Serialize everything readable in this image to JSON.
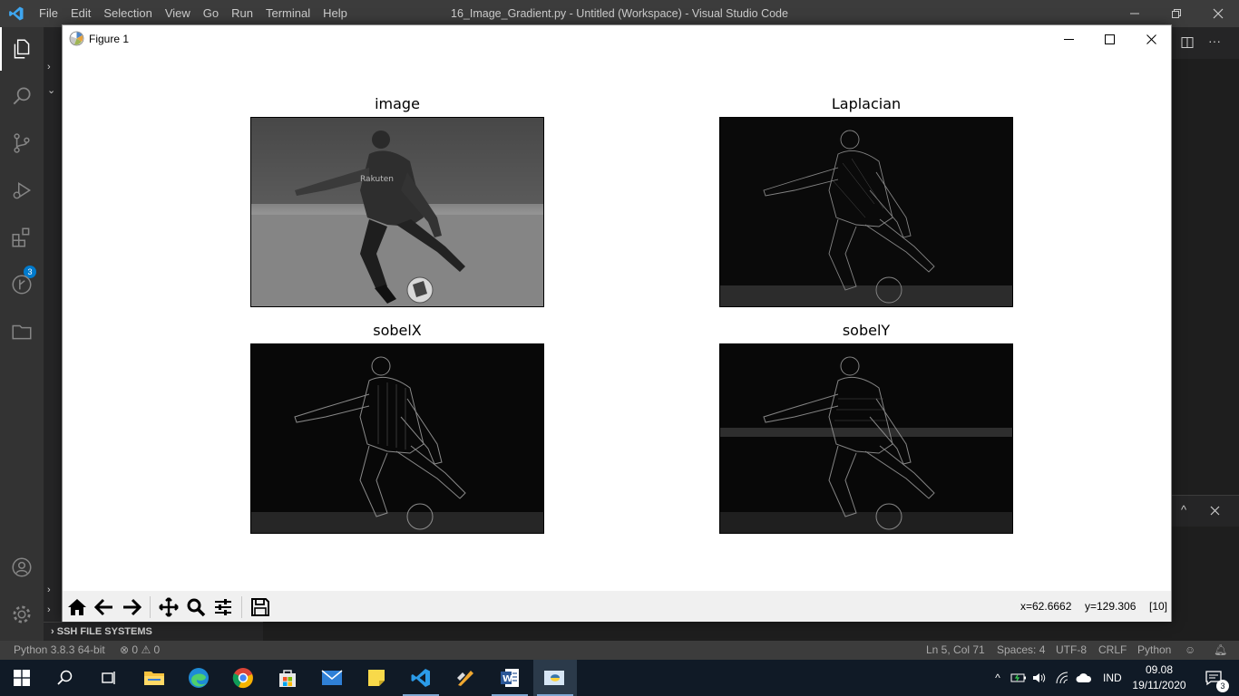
{
  "vscode": {
    "menu": [
      "File",
      "Edit",
      "Selection",
      "View",
      "Go",
      "Run",
      "Terminal",
      "Help"
    ],
    "window_title": "16_Image_Gradient.py - Untitled (Workspace) - Visual Studio Code",
    "activity_badge": "3",
    "ssh_section": "SSH FILE SYSTEMS"
  },
  "statusbar": {
    "python": "Python 3.8.3 64-bit",
    "errors": "0",
    "warnings": "0",
    "position": "Ln 5, Col 71",
    "spaces": "Spaces: 4",
    "encoding": "UTF-8",
    "eol": "CRLF",
    "language": "Python"
  },
  "figure": {
    "title": "Figure 1",
    "subplots": [
      {
        "title": "image",
        "content": "grayscale photo of a footballer kicking a ball"
      },
      {
        "title": "Laplacian",
        "content": "Laplacian edge map"
      },
      {
        "title": "sobelX",
        "content": "Sobel X gradient"
      },
      {
        "title": "sobelY",
        "content": "Sobel Y gradient"
      }
    ],
    "toolbar": {
      "x_readout": "x=62.6662",
      "y_readout": "y=129.306",
      "value_readout": "[10]"
    }
  },
  "taskbar": {
    "language": "IND",
    "time": "09.08",
    "date": "19/11/2020",
    "notification_count": "3"
  }
}
